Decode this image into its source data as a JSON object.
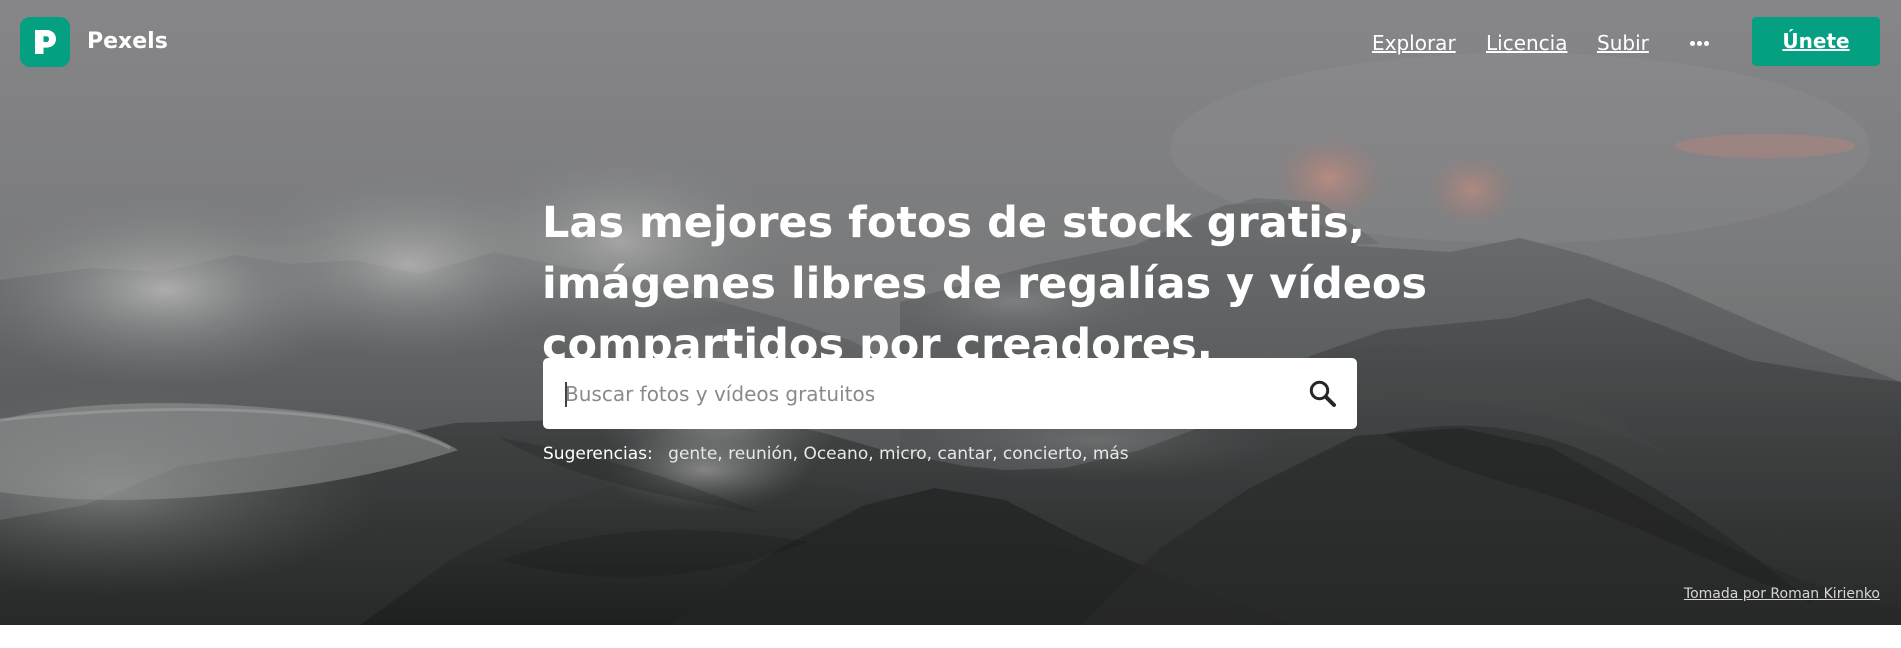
{
  "brand": {
    "name": "Pexels"
  },
  "navigation": {
    "explore": "Explorar",
    "license": "Licencia",
    "upload": "Subir",
    "more_icon": "more-horizontal-icon",
    "join": "Únete"
  },
  "hero": {
    "headline_lines": [
      "Las mejores fotos de stock gratis,",
      "imágenes libres de regalías y vídeos",
      "compartidos por creadores."
    ],
    "search": {
      "value": "",
      "placeholder": "Buscar fotos y vídeos gratuitos",
      "icon": "search-icon"
    },
    "suggestions": {
      "label": "Sugerencias:",
      "terms": "gente, reunión, Oceano, micro, cantar, concierto, más"
    },
    "credit": "Tomada por Roman Kirienko"
  },
  "colors": {
    "accent": "#05a081",
    "header_text": "#ffffff",
    "search_background": "#ffffff",
    "placeholder": "#8a8a8a"
  }
}
